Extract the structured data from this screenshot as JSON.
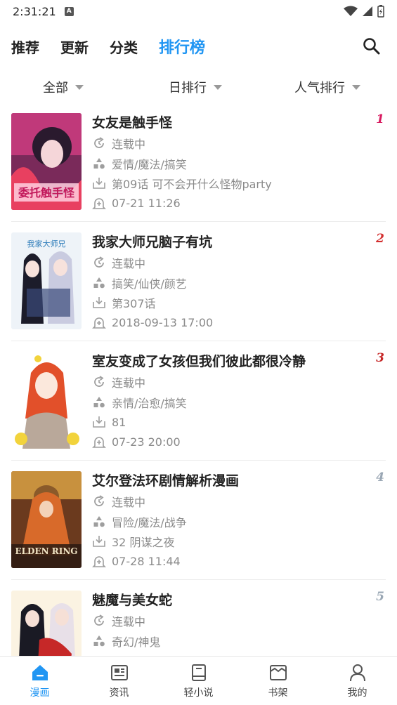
{
  "status_bar": {
    "time": "2:31:21",
    "notif_glyph": "A"
  },
  "top_tabs": [
    {
      "label": "推荐",
      "active": false
    },
    {
      "label": "更新",
      "active": false
    },
    {
      "label": "分类",
      "active": false
    },
    {
      "label": "排行榜",
      "active": true
    }
  ],
  "filters": {
    "category": "全部",
    "period": "日排行",
    "sort": "人气排行"
  },
  "colors": {
    "accent": "#2196f3",
    "meta_text": "#8a8a8a",
    "icon_gray": "#9e9e9e"
  },
  "items": [
    {
      "rank": "1",
      "rank_color": "#d81b60",
      "title": "女友是触手怪",
      "status": "连载中",
      "tags": "爱情/魔法/搞笑",
      "latest": "第09话 可不会开什么怪物party",
      "updated": "07-21 11:26"
    },
    {
      "rank": "2",
      "rank_color": "#d32f2f",
      "title": "我家大师兄脑子有坑",
      "status": "连载中",
      "tags": "搞笑/仙侠/颜艺",
      "latest": "第307话",
      "updated": "2018-09-13 17:00"
    },
    {
      "rank": "3",
      "rank_color": "#c62828",
      "title": "室友变成了女孩但我们彼此都很冷静",
      "status": "连载中",
      "tags": "亲情/治愈/搞笑",
      "latest": "81",
      "updated": "07-23 20:00"
    },
    {
      "rank": "4",
      "rank_color": "#9aa7b4",
      "title": "艾尔登法环剧情解析漫画",
      "status": "连载中",
      "tags": "冒险/魔法/战争",
      "latest": "32 阴谋之夜",
      "updated": "07-28 11:44"
    },
    {
      "rank": "5",
      "rank_color": "#9aa7b4",
      "title": "魅魔与美女蛇",
      "status": "连载中",
      "tags": "奇幻/神鬼",
      "latest": "",
      "updated": ""
    }
  ],
  "covers": [
    {
      "text": "委托触手怪"
    },
    {
      "text": "我家大师兄"
    },
    {
      "text": ""
    },
    {
      "text": "ELDEN RING"
    },
    {
      "text": ""
    }
  ],
  "bottom_nav": [
    {
      "label": "漫画",
      "icon": "home-icon",
      "active": true
    },
    {
      "label": "资讯",
      "icon": "news-icon",
      "active": false
    },
    {
      "label": "轻小说",
      "icon": "book-icon",
      "active": false
    },
    {
      "label": "书架",
      "icon": "bookshelf-icon",
      "active": false
    },
    {
      "label": "我的",
      "icon": "profile-icon",
      "active": false
    }
  ]
}
